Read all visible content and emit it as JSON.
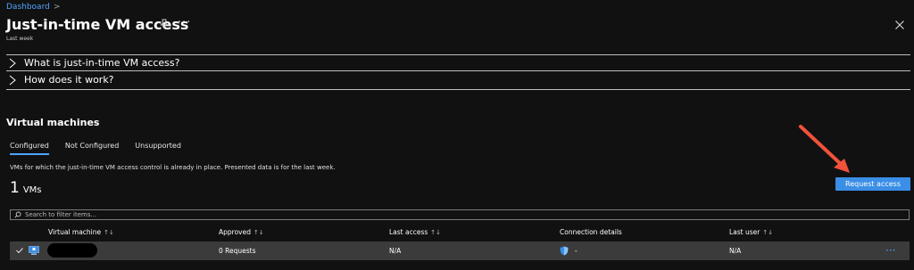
{
  "breadcrumb": {
    "item": "Dashboard",
    "separator": ">"
  },
  "header": {
    "title": "Just-in-time VM access",
    "more": "···",
    "subtitle": "Last week"
  },
  "expanders": [
    {
      "label": "What is just-in-time VM access?"
    },
    {
      "label": "How does it work?"
    }
  ],
  "section": {
    "title": "Virtual machines"
  },
  "tabs": [
    {
      "label": "Configured"
    },
    {
      "label": "Not Configured"
    },
    {
      "label": "Unsupported"
    }
  ],
  "description": "VMs for which the just-in-time VM access control is already in place. Presented data is for the last week.",
  "vm_count": {
    "number": "1",
    "unit": "VMs"
  },
  "request_button": {
    "label": "Request access"
  },
  "search": {
    "placeholder": "Search to filter items..."
  },
  "table": {
    "headers": [
      "Virtual machine",
      "Approved",
      "Last access",
      "Connection details",
      "Last user"
    ],
    "sort_glyph": "↑↓",
    "rows": [
      {
        "approved": "0 Requests",
        "last_access": "N/A",
        "connection": "-",
        "last_user": "N/A",
        "more": "···"
      }
    ]
  },
  "colors": {
    "accent": "#3a8ee6",
    "link": "#4fa3ff",
    "background": "#111111",
    "row_selected": "#3b3b3b"
  }
}
